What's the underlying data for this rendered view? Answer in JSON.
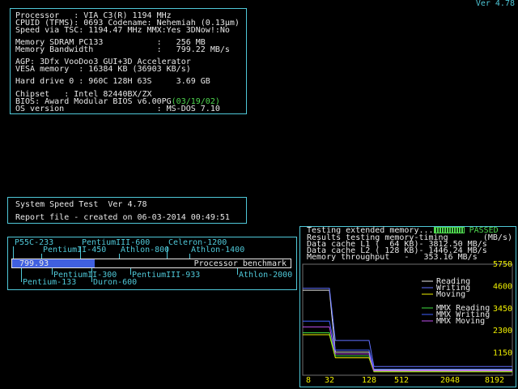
{
  "version": "Ver 4.78",
  "sysinfo": {
    "lines": [
      "Processor   : VIA C3(R) 1194 MHz",
      "CPUID (TFMS): 0693 Codename: Nehemiah (0.13μm)",
      "Speed via TSC: 1194.47 MHz MMX:Yes 3DNow!:No",
      "Memory SDRAM PC133           :   256 MB",
      "Memory Bandwidth             :   799.22 MB/s",
      "AGP: 3Dfx VooDoo3 GUI+3D Accelerator",
      "VESA memory  : 16384 KB (36903 KB/s)",
      "Hard drive 0 : 960C 128H 63S     3.69 GB",
      "Chipset   : Intel 82440BX/ZX",
      "BIOS: Award Modular BIOS v6.00PG",
      "OS version                   : MS-DOS 7.10"
    ],
    "bios_date": "(03/19/02)"
  },
  "speedtest": {
    "title": "System Speed Test  Ver 4.78",
    "report": "Report file - created on 06-03-2014 00:49:51"
  },
  "benchmark": {
    "value": "799.93",
    "caption": "Processor benchmark",
    "fill_fraction": 0.295,
    "cpus_top": [
      {
        "label": "P55C-233",
        "pos": 0.0
      },
      {
        "label": "PentiumIII-600",
        "pos": 0.24
      },
      {
        "label": "Celeron-1200",
        "pos": 0.55
      },
      {
        "label": "PentiumII-450",
        "pos": 0.1
      },
      {
        "label": "Athlon-800",
        "pos": 0.38
      },
      {
        "label": "Athlon-1400",
        "pos": 0.63
      }
    ],
    "cpus_bottom": [
      {
        "label": "PentiumII-300",
        "pos": 0.14
      },
      {
        "label": "PentiumIII-933",
        "pos": 0.42
      },
      {
        "label": "Athlon-2000",
        "pos": 0.8
      },
      {
        "label": "Pentium-133",
        "pos": 0.03
      },
      {
        "label": "Duron-600",
        "pos": 0.28
      }
    ]
  },
  "memtest": {
    "status_text": "Testing extended memory...",
    "status": "PASSED",
    "results_header": "Results testing memory-timing",
    "units": "(MB/s)",
    "l1": "Data cache L1 (  64 KB)- 3812.50 MB/s",
    "l2": "Data cache L2 ( 128 KB)- 1446.24 MB/s",
    "throughput": "Memory throughput   -   353.16 MB/s"
  },
  "chart_data": {
    "type": "line",
    "x": [
      8,
      32,
      128,
      512,
      2048,
      8192
    ],
    "x_tick_labels": [
      "8",
      "32",
      "128",
      "512",
      "2048",
      "8192"
    ],
    "y_tick_labels": [
      "5750",
      "4600",
      "3450",
      "2300",
      "1150"
    ],
    "ylim": [
      0,
      5750
    ],
    "legend_position": "right",
    "series": [
      {
        "name": "Reading",
        "color": "#e8e8e8",
        "values": [
          4400,
          4400,
          1200,
          270,
          270,
          270
        ]
      },
      {
        "name": "Writing",
        "color": "#6070ff",
        "values": [
          4500,
          4500,
          1800,
          450,
          450,
          450
        ]
      },
      {
        "name": "Moving",
        "color": "#f0f000",
        "values": [
          2100,
          2100,
          900,
          180,
          180,
          180
        ]
      },
      {
        "name": "MMX Reading",
        "color": "#40e040",
        "values": [
          2200,
          2200,
          1000,
          210,
          210,
          210
        ]
      },
      {
        "name": "MMX Writing",
        "color": "#4060ff",
        "values": [
          2800,
          2800,
          1300,
          320,
          320,
          320
        ]
      },
      {
        "name": "MMX Moving",
        "color": "#c050f0",
        "values": [
          2500,
          2500,
          1100,
          230,
          230,
          230
        ]
      }
    ]
  }
}
